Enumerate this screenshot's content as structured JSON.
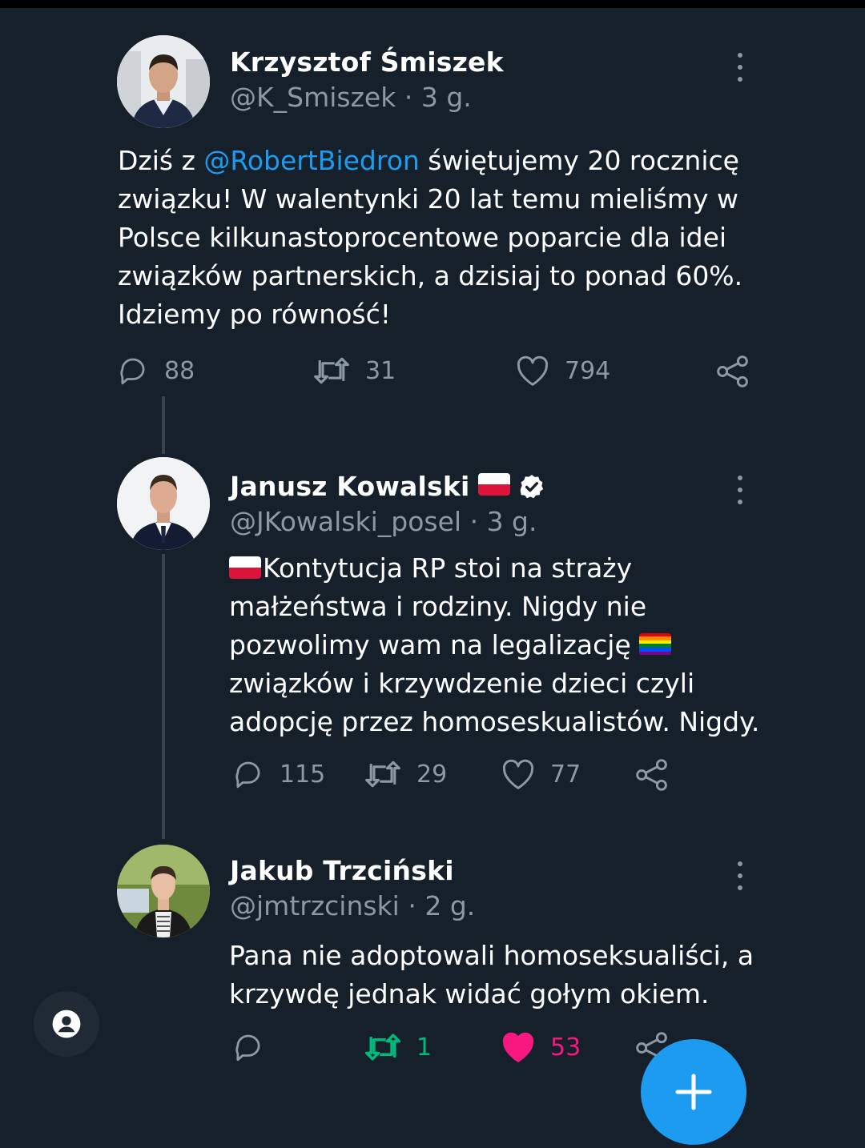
{
  "tweets": [
    {
      "name": "Krzysztof Śmiszek",
      "handle": "@K_Smiszek",
      "sep": " · ",
      "time": "3 g.",
      "text_lines": [
        {
          "pre": "Dziś z ",
          "mention": "@RobertBiedron",
          "post": " świętujemy 20 rocznicę"
        },
        {
          "pre": "związku! W walentynki 20 lat temu mieliśmy w"
        },
        {
          "pre": "Polsce kilkunastoprocentowe poparcie dla idei"
        },
        {
          "pre": "związków partnerskich, a dzisiaj to ponad 60%."
        },
        {
          "pre": "Idziemy po równość!"
        }
      ],
      "replies": "88",
      "retweets": "31",
      "likes": "794"
    },
    {
      "name": "Janusz Kowalski",
      "handle": "@JKowalski_posel",
      "sep": " · ",
      "time": "3 g.",
      "text_lines": [
        "Kontytucja RP stoi na straży",
        "małżeństwa i rodziny. Nigdy nie",
        "pozwolimy wam na legalizację",
        "związków i krzywdzenie dzieci czyli",
        "adopcję przez homoseskualistów. Nigdy."
      ],
      "replies": "115",
      "retweets": "29",
      "likes": "77"
    },
    {
      "name": "Jakub Trzciński",
      "handle": "@jmtrzcinski",
      "sep": " · ",
      "time": "2 g.",
      "text_lines": [
        "Pana nie adoptowali homoseksualiści, a",
        "krzywdę jednak widać gołym okiem."
      ],
      "replies": "",
      "retweets": "1",
      "likes": "53"
    }
  ],
  "colors": {
    "background": "#15202b",
    "secondary_text": "#8b98a5",
    "accent": "#1d9bf0",
    "retweet_active": "#00ba7c",
    "like_active": "#f91880"
  },
  "icons": [
    "reply-icon",
    "retweet-icon",
    "like-icon",
    "share-icon",
    "verified-icon",
    "more-icon",
    "profile-icon"
  ]
}
